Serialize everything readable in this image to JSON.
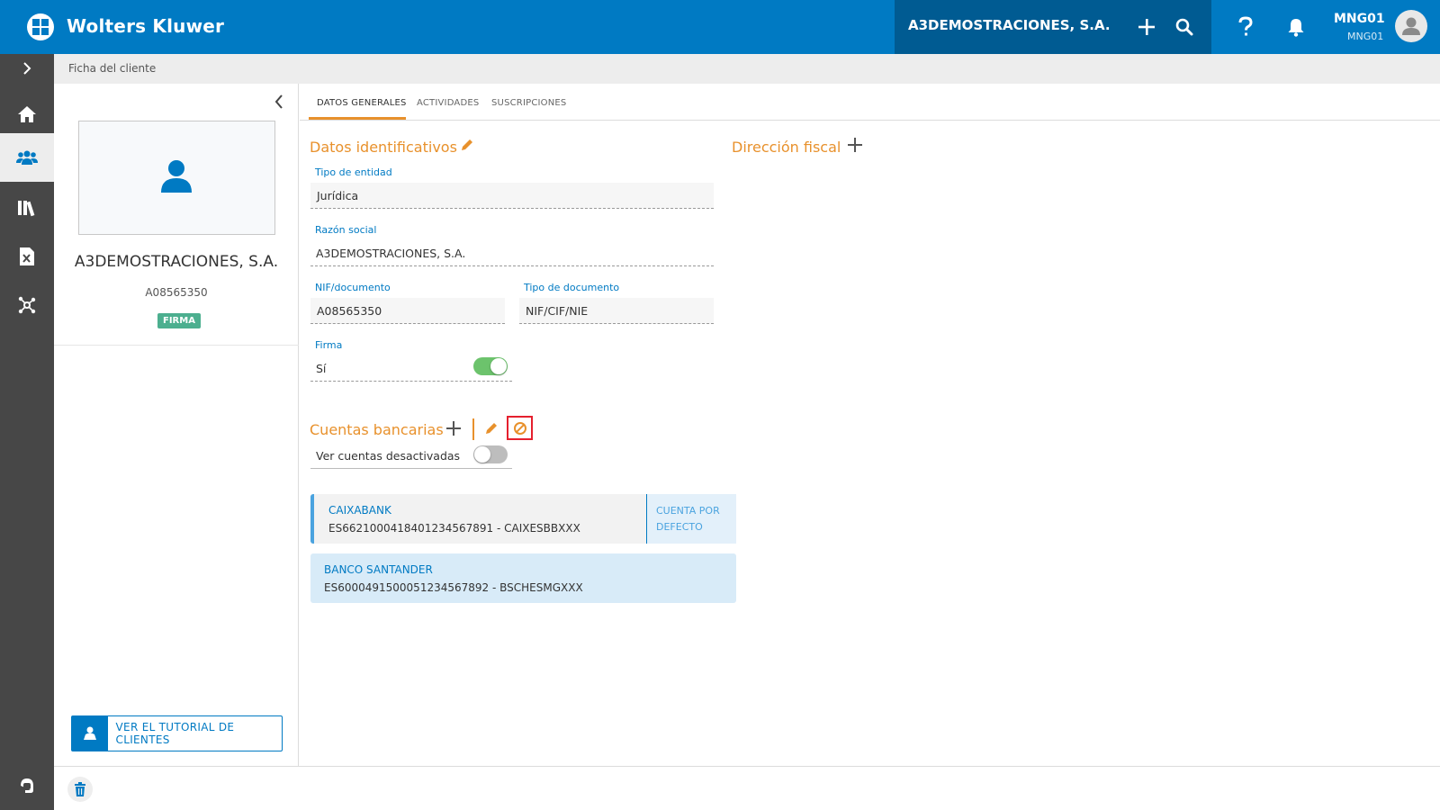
{
  "header": {
    "brand": "Wolters Kluwer",
    "company": "A3DEMOSTRACIONES, S.A.",
    "user_name": "MNG01",
    "user_sub": "MNG01",
    "icons": [
      "plus-icon",
      "search-icon",
      "help-icon",
      "bell-icon",
      "avatar-icon"
    ]
  },
  "nav": {
    "items": [
      "chevron-right-icon",
      "home-icon",
      "clients-icon",
      "library-icon",
      "excel-file-icon",
      "network-icon",
      "support-icon"
    ],
    "active": "clients-icon"
  },
  "breadcrumb": "Ficha del cliente",
  "profile": {
    "name": "A3DEMOSTRACIONES, S.A.",
    "nif": "A08565350",
    "badge": "FIRMA",
    "tutorial_label": "VER EL TUTORIAL DE CLIENTES"
  },
  "tabs": [
    {
      "label": "DATOS GENERALES",
      "active": true
    },
    {
      "label": "ACTIVIDADES",
      "active": false
    },
    {
      "label": "SUSCRIPCIONES",
      "active": false
    }
  ],
  "datos": {
    "title": "Datos identificativos",
    "tipo_entidad_label": "Tipo de entidad",
    "tipo_entidad_value": "Jurídica",
    "razon_label": "Razón social",
    "razon_value": "A3DEMOSTRACIONES, S.A.",
    "nif_label": "NIF/documento",
    "nif_value": "A08565350",
    "tipo_doc_label": "Tipo de documento",
    "tipo_doc_value": "NIF/CIF/NIE",
    "firma_label": "Firma",
    "firma_value": "Sí",
    "firma_on": true
  },
  "direccion": {
    "title": "Dirección fiscal"
  },
  "cuentas": {
    "title": "Cuentas bancarias",
    "ver_desactivadas_label": "Ver cuentas desactivadas",
    "ver_desactivadas_on": false,
    "accounts": [
      {
        "bank": "CAIXABANK",
        "iban": "ES6621000418401234567891 - CAIXESBBXXX",
        "default_label_1": "CUENTA POR",
        "default_label_2": "DEFECTO"
      },
      {
        "bank": "BANCO SANTANDER",
        "iban": "ES6000491500051234567892 - BSCHESMGXXX"
      }
    ]
  },
  "colors": {
    "primary": "#007ac3",
    "primary_dark": "#005b92",
    "accent": "#e8912c",
    "toggle_on": "#6cc36c",
    "highlight": "#e5202e"
  }
}
